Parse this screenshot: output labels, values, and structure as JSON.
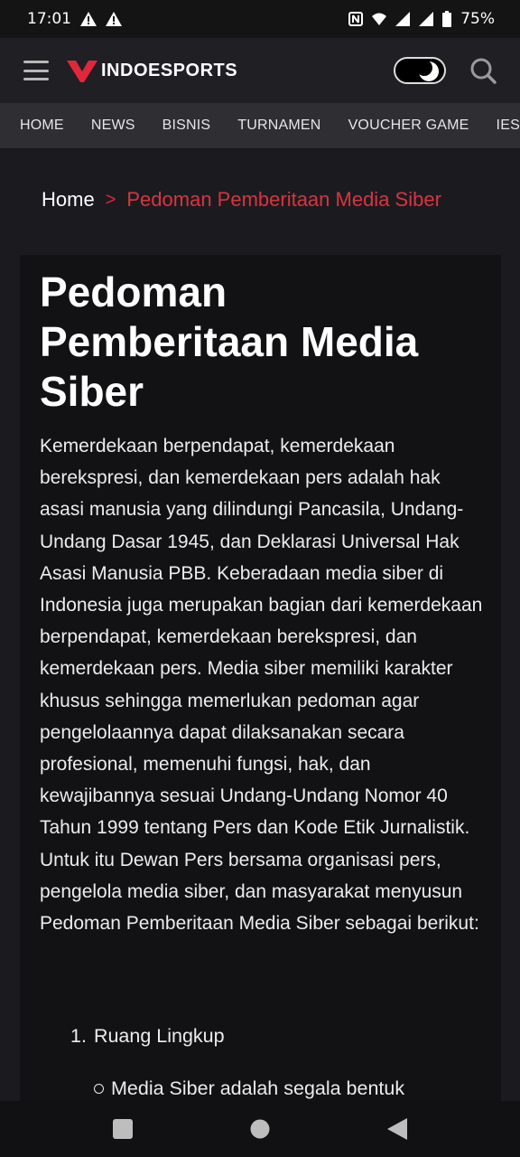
{
  "status_bar": {
    "time": "17:01",
    "battery": "75%"
  },
  "header": {
    "brand": "INDOESPORTS",
    "accent_color": "#e0283a"
  },
  "nav": {
    "items": [
      "HOME",
      "NEWS",
      "BISNIS",
      "TURNAMEN",
      "VOUCHER GAME",
      "IES"
    ]
  },
  "breadcrumb": {
    "home": "Home",
    "separator": ">",
    "current": "Pedoman Pemberitaan Media Siber"
  },
  "article": {
    "title": "Pedoman Pemberitaan Media Siber",
    "intro": "Kemerdekaan berpendapat, kemerdekaan berekspresi, dan kemerdekaan pers adalah hak asasi manusia yang dilindungi Pancasila, Undang-Undang Dasar 1945, dan Deklarasi Universal Hak Asasi Manusia PBB. Keberadaan media siber di Indonesia juga merupakan bagian dari kemerdekaan berpendapat, kemerdekaan berekspresi, dan kemerdekaan pers. Media siber memiliki karakter khusus sehingga memerlukan pedoman agar pengelolaannya dapat dilaksanakan secara profesional, memenuhi fungsi, hak, dan kewajibannya sesuai Undang-Undang Nomor 40 Tahun 1999 tentang Pers dan Kode Etik Jurnalistik. Untuk itu Dewan Pers bersama organisasi pers, pengelola media siber, dan masyarakat menyusun Pedoman Pemberitaan Media Siber sebagai berikut:",
    "list_number": "1.",
    "list_item": "Ruang Lingkup",
    "sub_item": "Media Siber adalah segala bentuk"
  }
}
